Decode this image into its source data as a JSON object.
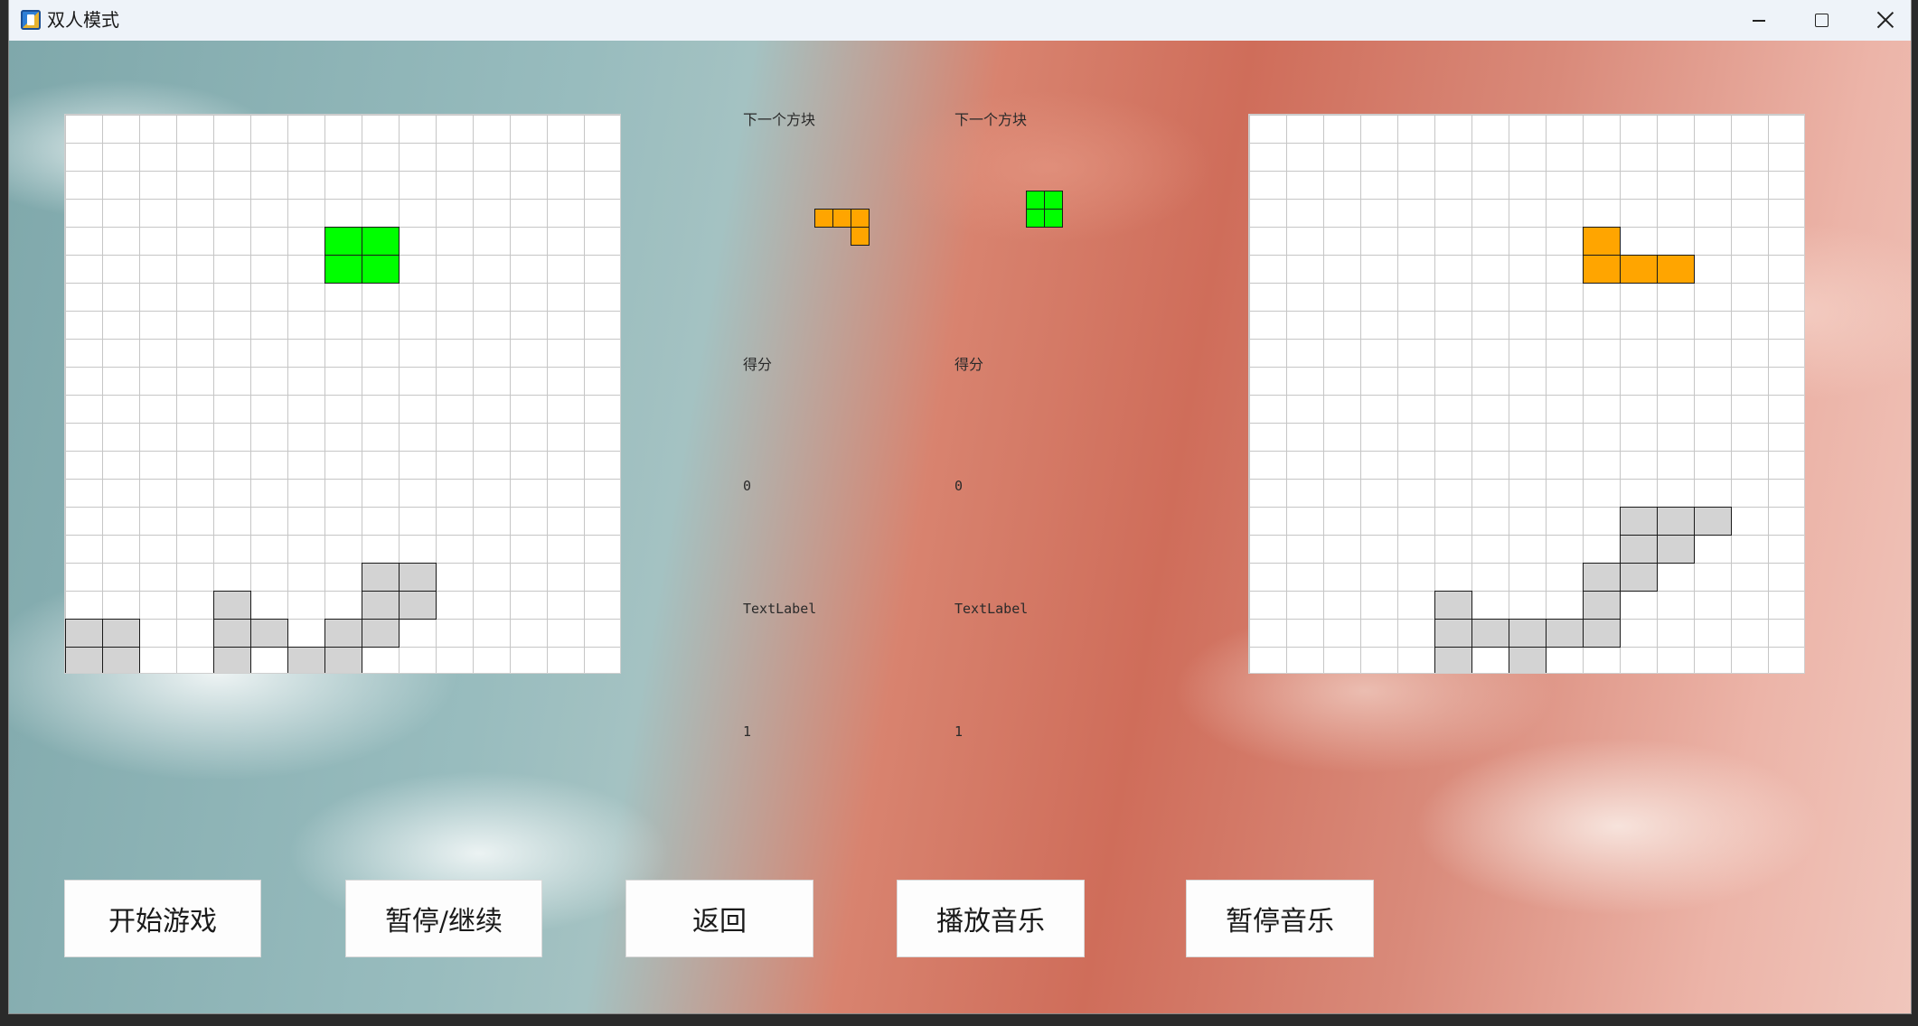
{
  "window": {
    "title": "双人模式",
    "icon": "app-icon"
  },
  "board_colors": {
    "grid": "#c6c6c6",
    "settled": "#d3d3d3",
    "green": "#00ff00",
    "orange": "#ffa500",
    "border": "#1a1a1a"
  },
  "player1": {
    "next_label": "下一个方块",
    "score_label": "得分",
    "score": "0",
    "text_label": "TextLabel",
    "level": "1",
    "next_piece": {
      "color": "#ffa500",
      "cells": [
        [
          0,
          0
        ],
        [
          1,
          0
        ],
        [
          2,
          0
        ],
        [
          2,
          1
        ]
      ]
    },
    "board": {
      "cols": 15,
      "rows": 20,
      "active": {
        "color": "#00ff00",
        "cells": [
          [
            7,
            4
          ],
          [
            8,
            4
          ],
          [
            7,
            5
          ],
          [
            8,
            5
          ]
        ]
      },
      "settled": [
        [
          8,
          16
        ],
        [
          9,
          16
        ],
        [
          8,
          17
        ],
        [
          9,
          17
        ],
        [
          4,
          17
        ],
        [
          0,
          18
        ],
        [
          1,
          18
        ],
        [
          4,
          18
        ],
        [
          5,
          18
        ],
        [
          7,
          18
        ],
        [
          8,
          18
        ],
        [
          0,
          19
        ],
        [
          1,
          19
        ],
        [
          4,
          19
        ],
        [
          6,
          19
        ],
        [
          7,
          19
        ]
      ]
    }
  },
  "player2": {
    "next_label": "下一个方块",
    "score_label": "得分",
    "score": "0",
    "text_label": "TextLabel",
    "level": "1",
    "next_piece": {
      "color": "#00ff00",
      "cells": [
        [
          0,
          0
        ],
        [
          1,
          0
        ],
        [
          0,
          1
        ],
        [
          1,
          1
        ]
      ]
    },
    "board": {
      "cols": 15,
      "rows": 20,
      "active": {
        "color": "#ffa500",
        "cells": [
          [
            9,
            4
          ],
          [
            9,
            5
          ],
          [
            10,
            5
          ],
          [
            11,
            5
          ]
        ]
      },
      "settled": [
        [
          10,
          14
        ],
        [
          11,
          14
        ],
        [
          12,
          14
        ],
        [
          10,
          15
        ],
        [
          11,
          15
        ],
        [
          9,
          16
        ],
        [
          10,
          16
        ],
        [
          5,
          17
        ],
        [
          9,
          17
        ],
        [
          5,
          18
        ],
        [
          6,
          18
        ],
        [
          7,
          18
        ],
        [
          8,
          18
        ],
        [
          9,
          18
        ],
        [
          5,
          19
        ],
        [
          7,
          19
        ]
      ]
    }
  },
  "buttons": {
    "start": "开始游戏",
    "pause_resume": "暂停/继续",
    "back": "返回",
    "play_music": "播放音乐",
    "pause_music": "暂停音乐"
  }
}
